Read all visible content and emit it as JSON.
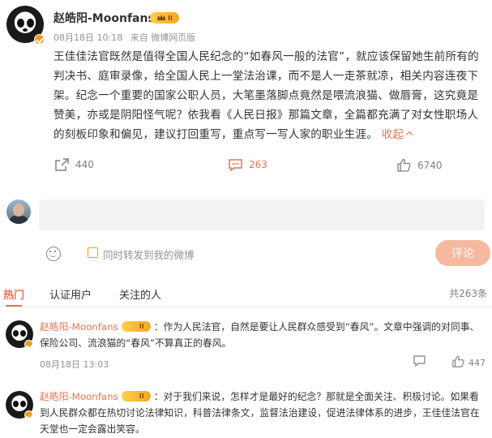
{
  "post": {
    "author": "赵皓阳-Moonfans",
    "vip_level": "II",
    "date": "08月18日 10:18",
    "source": "来自 微博网页版",
    "lines": [
      "王佳佳法官既然是值得全国人民纪念的“如春风一般的法官”，就应该保留她生前所有的",
      "判决书、庭审录像，给全国人民上一堂法治课，而不是人一走茶就凉，相关内容连夜下",
      "架。纪念一个重要的国家公职人员，大笔墨落脚点竟然是喂流浪猫、做唇膏，这究竟是",
      "赞美，亦或是阴阳怪气呢？依我看《人民日报》那篇文章，全篇都充满了对女性职场人",
      "的刻板印象和偏见，建议打回重写，重点写一写人家的职业生涯。"
    ],
    "collapse_label": "收起",
    "reposts": "440",
    "comments": "263",
    "likes": "6740"
  },
  "composer": {
    "placeholder": "",
    "repost_label": "同时转发到我的微博",
    "submit_label": "评论"
  },
  "comment_tabs": {
    "tabs": [
      "热门",
      "认证用户",
      "关注的人"
    ],
    "total": "共263条"
  },
  "comments": [
    {
      "author": "赵皓阳-Moonfans",
      "text_line1": "：作为人民法官，自然是要让人民群众感受到“春风”。文章中强调的对同事、",
      "text_line2": "保险公司、流浪猫的“春风”不算真正的春风。",
      "time": "08月18日 13:03",
      "likes": "447"
    },
    {
      "author": "赵皓阳-Moonfans",
      "text_line1": "：对于我们来说，怎样才是最好的纪念？那就是全面关注、积极讨论。如果看",
      "text_line2": "到人民群众都在热切讨论法律知识，科普法律条文，监督法治建设，促进法律体系的进步，王佳佳法官在",
      "text_line3": "天堂也一定会露出笑容。"
    }
  ],
  "colors": {
    "accent": "#eb7350",
    "vip_gold": "#f6a623",
    "muted": "#939393"
  }
}
